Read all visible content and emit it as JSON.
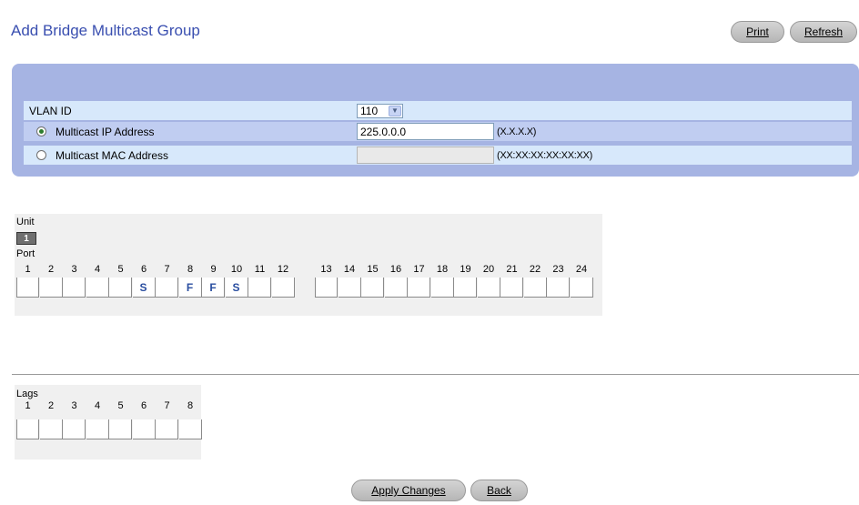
{
  "page": {
    "title": "Add Bridge Multicast Group"
  },
  "toolbar": {
    "print_label": "Print",
    "refresh_label": "Refresh"
  },
  "form": {
    "vlan": {
      "label": "VLAN ID",
      "value": "110"
    },
    "ip": {
      "label": "Multicast IP Address",
      "value": "225.0.0.0",
      "hint": "(X.X.X.X)",
      "selected": true
    },
    "mac": {
      "label": "Multicast MAC Address",
      "value": "",
      "hint": "(XX:XX:XX:XX:XX:XX)",
      "selected": false
    }
  },
  "ports": {
    "unit_label": "Unit",
    "unit_value": "1",
    "port_label": "Port",
    "numbers": [
      "1",
      "2",
      "3",
      "4",
      "5",
      "6",
      "7",
      "8",
      "9",
      "10",
      "11",
      "12",
      "13",
      "14",
      "15",
      "16",
      "17",
      "18",
      "19",
      "20",
      "21",
      "22",
      "23",
      "24"
    ],
    "values": [
      "",
      "",
      "",
      "",
      "",
      "S",
      "",
      "F",
      "F",
      "S",
      "",
      "",
      "",
      "",
      "",
      "",
      "",
      "",
      "",
      "",
      "",
      "",
      "",
      ""
    ]
  },
  "lags": {
    "label": "Lags",
    "numbers": [
      "1",
      "2",
      "3",
      "4",
      "5",
      "6",
      "7",
      "8"
    ],
    "values": [
      "",
      "",
      "",
      "",
      "",
      "",
      "",
      ""
    ]
  },
  "actions": {
    "apply_label": "Apply Changes",
    "back_label": "Back"
  }
}
